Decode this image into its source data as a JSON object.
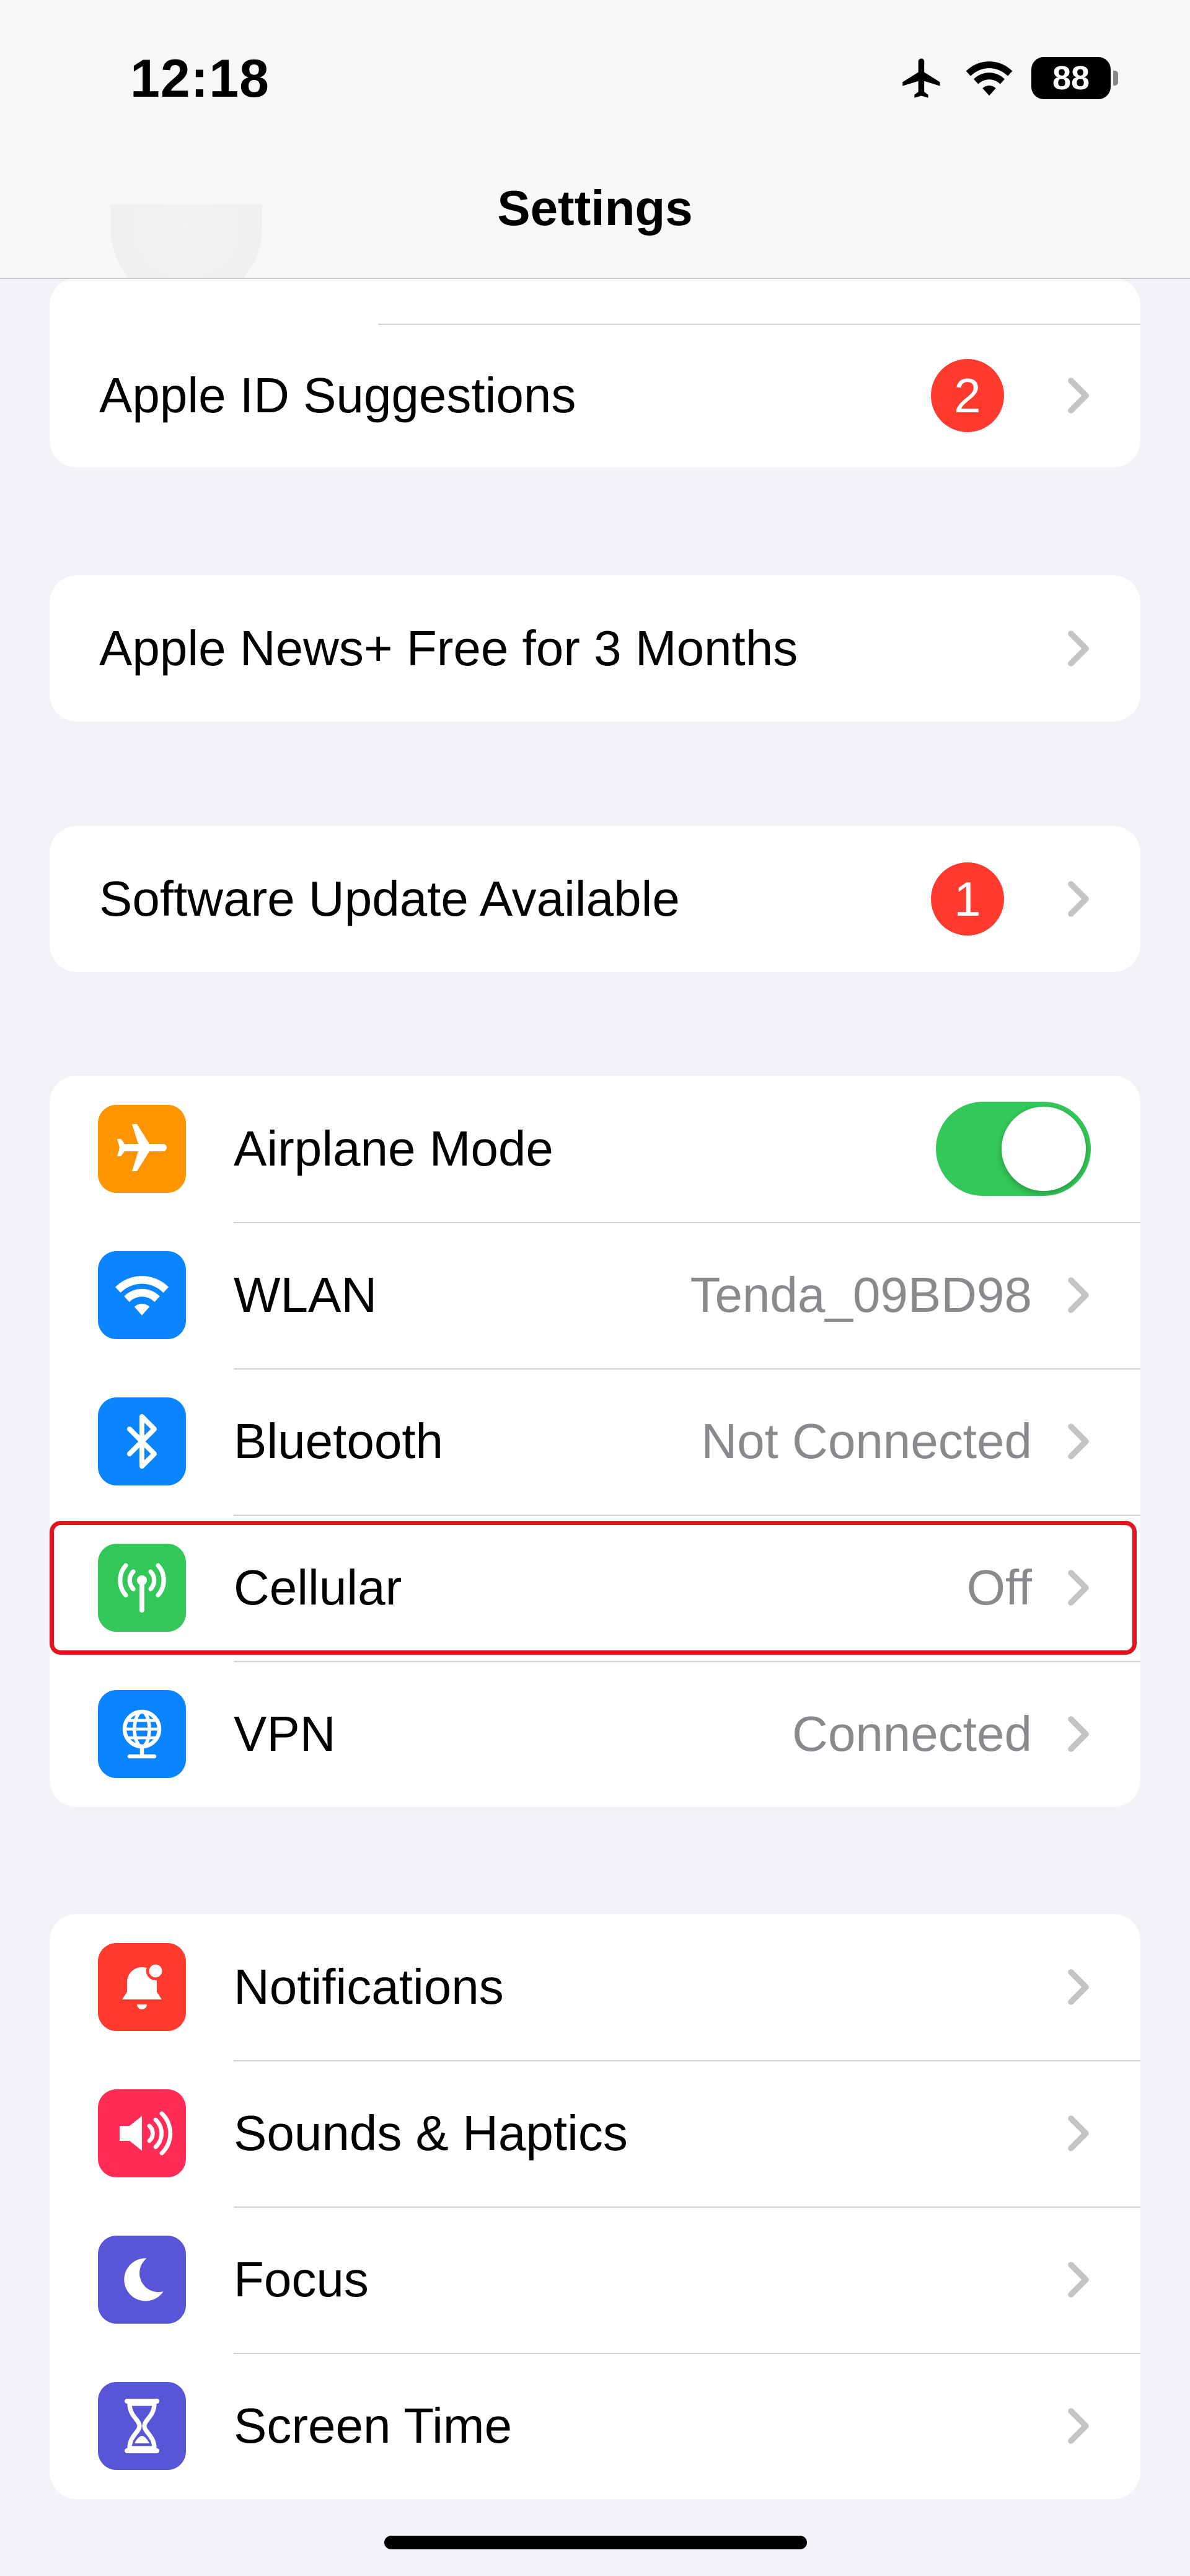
{
  "status_bar": {
    "time": "12:18",
    "battery": "88",
    "icons": [
      "airplane-icon",
      "wifi-icon",
      "battery-icon"
    ]
  },
  "nav": {
    "title": "Settings"
  },
  "account_group": [
    {
      "label": "Apple ID Suggestions",
      "badge": "2"
    }
  ],
  "news_group": [
    {
      "label": "Apple News+ Free for 3 Months"
    }
  ],
  "update_group": [
    {
      "label": "Software Update Available",
      "badge": "1"
    }
  ],
  "connectivity": [
    {
      "label": "Airplane Mode",
      "icon": "airplane-icon",
      "icon_color": "#ff9500",
      "toggle_on": true
    },
    {
      "label": "WLAN",
      "value": "Tenda_09BD98",
      "icon": "wifi-icon",
      "icon_color": "#0a84ff"
    },
    {
      "label": "Bluetooth",
      "value": "Not Connected",
      "icon": "bluetooth-icon",
      "icon_color": "#0a84ff"
    },
    {
      "label": "Cellular",
      "value": "Off",
      "icon": "cellular-antenna-icon",
      "icon_color": "#34c759",
      "highlighted": true
    },
    {
      "label": "VPN",
      "value": "Connected",
      "icon": "vpn-globe-icon",
      "icon_color": "#0a84ff"
    }
  ],
  "general": [
    {
      "label": "Notifications",
      "icon": "notification-bell-icon",
      "icon_color": "#ff3b30"
    },
    {
      "label": "Sounds & Haptics",
      "icon": "speaker-icon",
      "icon_color": "#ff2d55"
    },
    {
      "label": "Focus",
      "icon": "moon-icon",
      "icon_color": "#5856d6"
    },
    {
      "label": "Screen Time",
      "icon": "hourglass-icon",
      "icon_color": "#5856d6"
    }
  ],
  "colors": {
    "accent": "#0a84ff",
    "toggle_on": "#34c759",
    "badge": "#ff3b30",
    "highlight_box": "#e0161f"
  }
}
